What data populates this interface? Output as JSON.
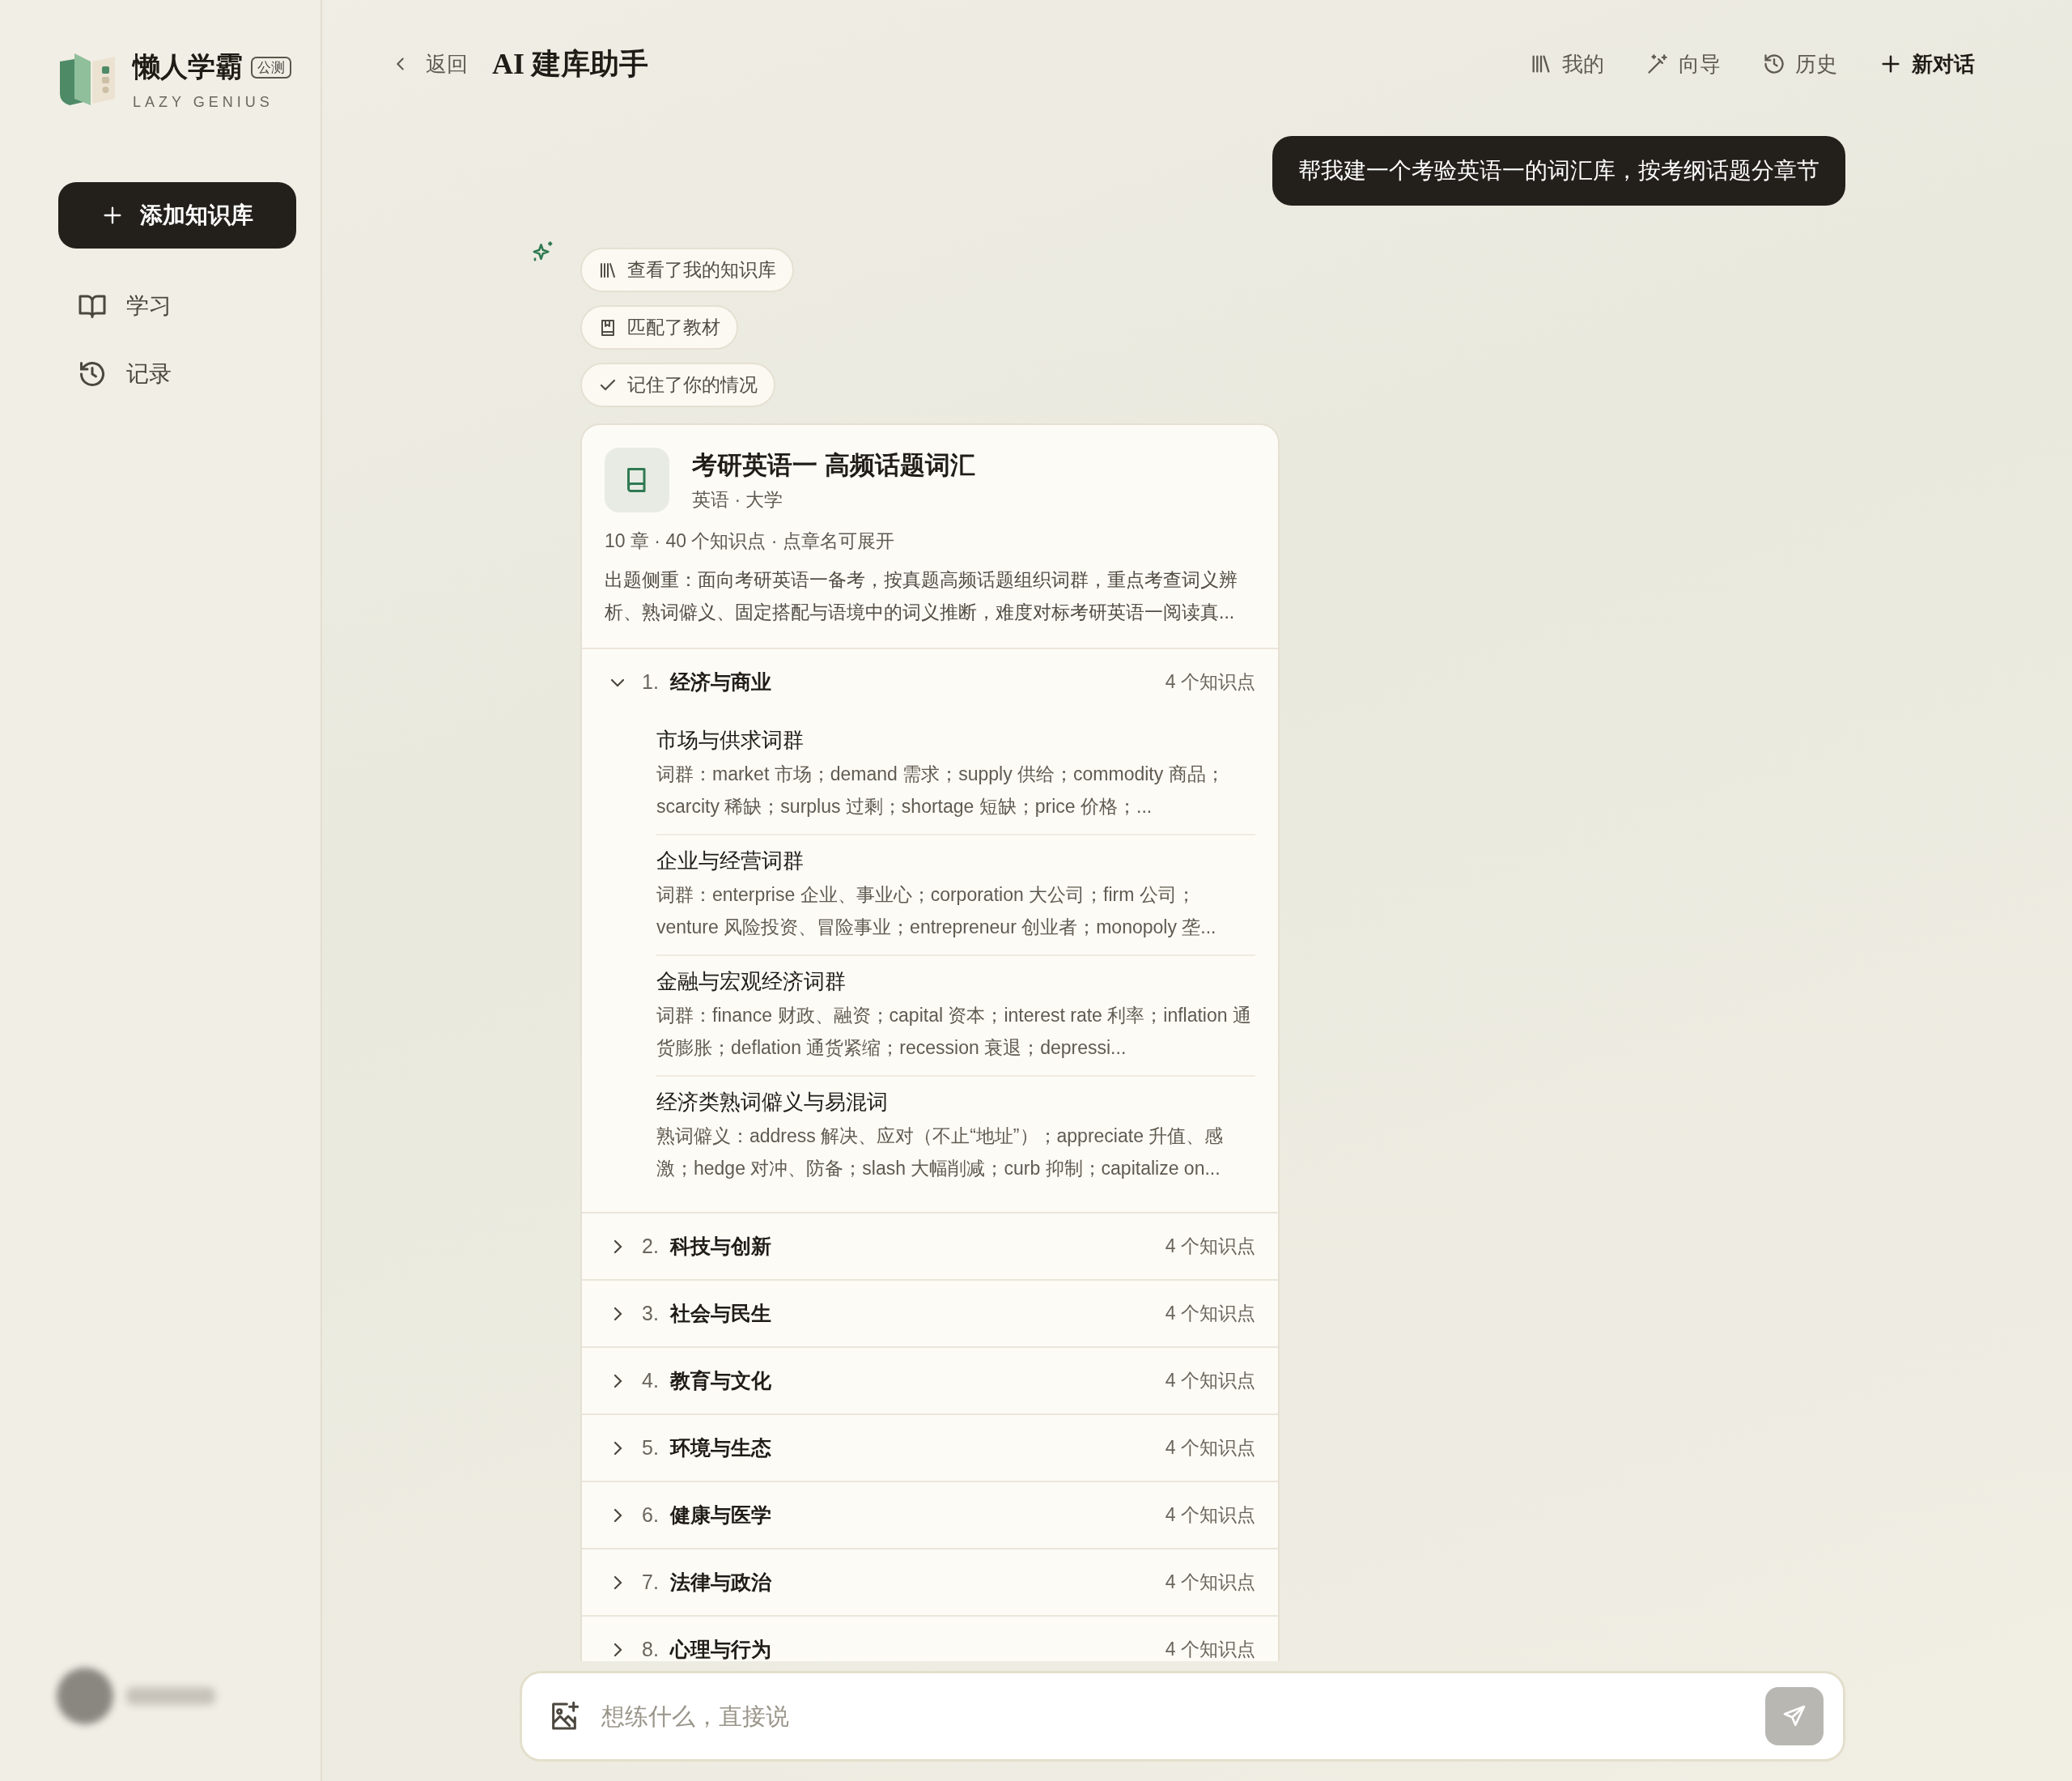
{
  "brand": {
    "name": "懒人学霸",
    "badge": "公测",
    "tagline": "LAZY GENIUS"
  },
  "add_button": {
    "label": "添加知识库"
  },
  "nav": [
    {
      "label": "学习",
      "kind": "book"
    },
    {
      "label": "记录",
      "kind": "history"
    }
  ],
  "header": {
    "back_label": "返回",
    "title": "AI 建库助手",
    "actions": [
      {
        "label": "我的",
        "kind": "library"
      },
      {
        "label": "向导",
        "kind": "wand"
      },
      {
        "label": "历史",
        "kind": "history"
      },
      {
        "label": "新对话",
        "kind": "new"
      }
    ]
  },
  "user_message": "帮我建一个考验英语一的词汇库，按考纲话题分章节",
  "steps": [
    {
      "label": "查看了我的知识库",
      "kind": "library"
    },
    {
      "label": "匹配了教材",
      "kind": "textbook"
    },
    {
      "label": "记住了你的情况",
      "kind": "check"
    }
  ],
  "card": {
    "title": "考研英语一 高频话题词汇",
    "subtitle": "英语 · 大学",
    "meta": "10 章 · 40 个知识点 · 点章名可展开",
    "description": "出题侧重：面向考研英语一备考，按真题高频话题组织词群，重点考查词义辨析、熟词僻义、固定搭配与语境中的词义推断，难度对标考研英语一阅读真...",
    "chapters": [
      {
        "number": "1.",
        "title": "经济与商业",
        "count": "4 个知识点",
        "expanded": true,
        "children": [
          {
            "title": "市场与供求词群",
            "desc": "词群：market 市场；demand 需求；supply 供给；commodity 商品；scarcity 稀缺；surplus 过剩；shortage 短缺；price 价格；..."
          },
          {
            "title": "企业与经营词群",
            "desc": "词群：enterprise 企业、事业心；corporation 大公司；firm 公司；venture 风险投资、冒险事业；entrepreneur 创业者；monopoly 垄..."
          },
          {
            "title": "金融与宏观经济词群",
            "desc": "词群：finance 财政、融资；capital 资本；interest rate 利率；inflation 通货膨胀；deflation 通货紧缩；recession 衰退；depressi..."
          },
          {
            "title": "经济类熟词僻义与易混词",
            "desc": "熟词僻义：address 解决、应对（不止“地址”）；appreciate 升值、感激；hedge 对冲、防备；slash 大幅削减；curb 抑制；capitalize on..."
          }
        ]
      },
      {
        "number": "2.",
        "title": "科技与创新",
        "count": "4 个知识点",
        "expanded": false
      },
      {
        "number": "3.",
        "title": "社会与民生",
        "count": "4 个知识点",
        "expanded": false
      },
      {
        "number": "4.",
        "title": "教育与文化",
        "count": "4 个知识点",
        "expanded": false
      },
      {
        "number": "5.",
        "title": "环境与生态",
        "count": "4 个知识点",
        "expanded": false
      },
      {
        "number": "6.",
        "title": "健康与医学",
        "count": "4 个知识点",
        "expanded": false
      },
      {
        "number": "7.",
        "title": "法律与政治",
        "count": "4 个知识点",
        "expanded": false
      },
      {
        "number": "8.",
        "title": "心理与行为",
        "count": "4 个知识点",
        "expanded": false
      }
    ]
  },
  "input": {
    "placeholder": "想练什么，直接说"
  }
}
